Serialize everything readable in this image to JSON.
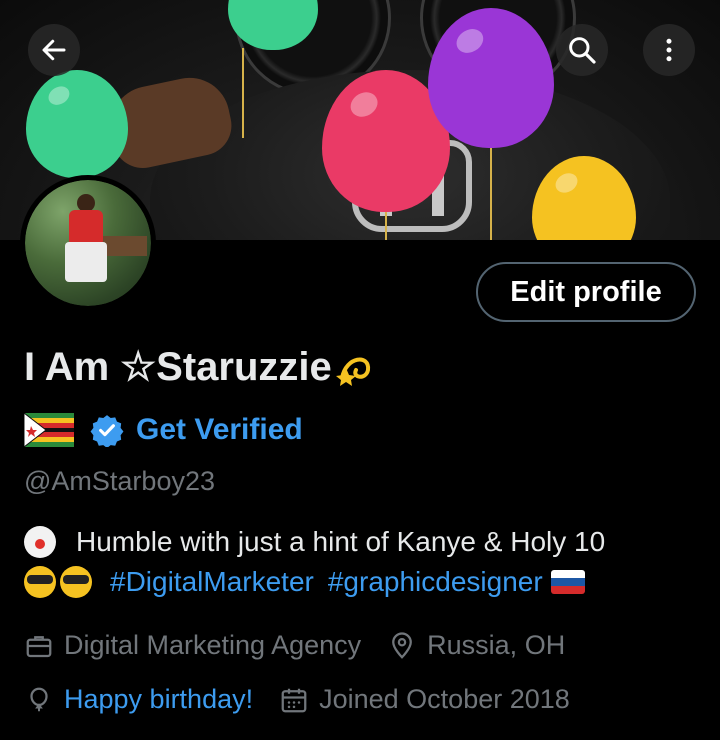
{
  "header": {
    "back_icon": "arrow-left-icon",
    "search_icon": "search-icon",
    "more_icon": "more-vertical-icon"
  },
  "profile": {
    "edit_button_label": "Edit profile",
    "display_name": "I Am ☆Staruzzie",
    "verify_link": "Get Verified",
    "handle": "@AmStarboy23",
    "bio_line1": "Humble with just a hint of Kanye & Holy 10",
    "hashtags": [
      "#DigitalMarketer",
      "#graphicdesigner"
    ],
    "category": "Digital Marketing Agency",
    "location": "Russia, OH",
    "birthday": "Happy birthday!",
    "joined": "Joined October 2018"
  },
  "colors": {
    "background": "#000000",
    "text_primary": "#e7e9ea",
    "text_secondary": "#71767b",
    "accent_blue": "#3d9cf0",
    "border": "#536471"
  }
}
